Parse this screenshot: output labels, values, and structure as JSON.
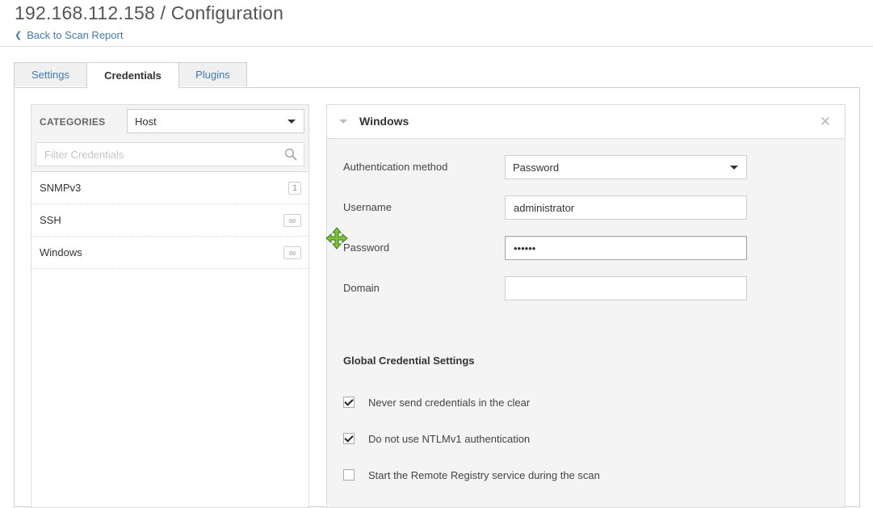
{
  "page": {
    "title": "192.168.112.158 / Configuration",
    "back_link": "Back to Scan Report"
  },
  "tabs": [
    {
      "label": "Settings",
      "active": false
    },
    {
      "label": "Credentials",
      "active": true
    },
    {
      "label": "Plugins",
      "active": false
    }
  ],
  "categories": {
    "label": "CATEGORIES",
    "selected": "Host",
    "filter_placeholder": "Filter Credentials",
    "items": [
      {
        "label": "SNMPv3",
        "count": "1"
      },
      {
        "label": "SSH",
        "count": "∞"
      },
      {
        "label": "Windows",
        "count": "∞"
      }
    ]
  },
  "windows_panel": {
    "title": "Windows",
    "auth_method_label": "Authentication method",
    "auth_method_value": "Password",
    "username_label": "Username",
    "username_value": "administrator",
    "password_label": "Password",
    "password_value": "••••••",
    "domain_label": "Domain",
    "domain_value": "",
    "global_title": "Global Credential Settings",
    "options": [
      {
        "label": "Never send credentials in the clear",
        "checked": true
      },
      {
        "label": "Do not use NTLMv1 authentication",
        "checked": true
      },
      {
        "label": "Start the Remote Registry service during the scan",
        "checked": false
      }
    ]
  },
  "colors": {
    "link": "#3f7bb5",
    "cursor": "#7cc43a"
  }
}
